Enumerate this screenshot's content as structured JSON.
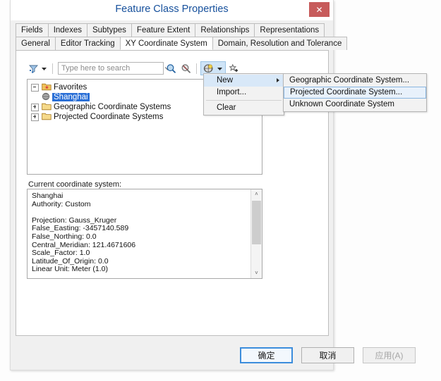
{
  "window": {
    "title": "Feature Class Properties",
    "close_label": "✕"
  },
  "tabs": {
    "row1": [
      {
        "label": "Fields",
        "active": false
      },
      {
        "label": "Indexes",
        "active": false
      },
      {
        "label": "Subtypes",
        "active": false
      },
      {
        "label": "Feature Extent",
        "active": false
      },
      {
        "label": "Relationships",
        "active": false
      },
      {
        "label": "Representations",
        "active": false
      }
    ],
    "row2": [
      {
        "label": "General",
        "active": false
      },
      {
        "label": "Editor Tracking",
        "active": false
      },
      {
        "label": "XY Coordinate System",
        "active": true
      },
      {
        "label": "Domain, Resolution and Tolerance",
        "active": false
      }
    ]
  },
  "toolbar": {
    "filter_icon": "filter-icon",
    "filter_dropdown_icon": "chevron-down-icon",
    "search_placeholder": "Type here to search",
    "search_value": "",
    "search_dropdown_icon": "chevron-down-icon",
    "search_button_icon": "magnifier-icon",
    "cancel_search_icon": "cancel-search-icon",
    "globe_icon": "globe-icon",
    "globe_dropdown_icon": "chevron-down-icon",
    "favorite_icon": "add-favorite-star-icon"
  },
  "tree": {
    "items": [
      {
        "label": "Favorites",
        "level": 0,
        "expander": "minus",
        "icon": "favorites-folder-icon",
        "selected": false
      },
      {
        "label": "Shanghai",
        "level": 1,
        "expander": "none",
        "icon": "globe-small-icon",
        "selected": true
      },
      {
        "label": "Geographic Coordinate Systems",
        "level": 0,
        "expander": "plus",
        "icon": "folder-icon",
        "selected": false
      },
      {
        "label": "Projected Coordinate Systems",
        "level": 0,
        "expander": "plus",
        "icon": "folder-icon",
        "selected": false
      }
    ]
  },
  "details": {
    "label": "Current coordinate system:",
    "text": "Shanghai\nAuthority: Custom\n\nProjection: Gauss_Kruger\nFalse_Easting: -3457140.589\nFalse_Northing: 0.0\nCentral_Meridian: 121.4671606\nScale_Factor: 1.0\nLatitude_Of_Origin: 0.0\nLinear Unit: Meter (1.0)",
    "scroll_up_icon": "˄",
    "scroll_down_icon": "˅"
  },
  "context_menu": {
    "items": [
      {
        "label": "New",
        "highlighted": true,
        "has_submenu": true
      },
      {
        "label": "Import...",
        "highlighted": false,
        "has_submenu": false
      },
      {
        "label": "Clear",
        "highlighted": false,
        "has_submenu": false
      }
    ]
  },
  "submenu": {
    "items": [
      {
        "label": "Geographic Coordinate System...",
        "hovered": false
      },
      {
        "label": "Projected Coordinate System...",
        "hovered": true
      },
      {
        "label": "Unknown Coordinate System",
        "hovered": false
      }
    ]
  },
  "buttons": {
    "ok": "确定",
    "cancel": "取消",
    "apply": "应用(A)"
  },
  "colors": {
    "title_text": "#16509c",
    "close_bg": "#c75b5b",
    "selection_blue": "#2a6fd6",
    "menu_highlight": "#d8e8f8",
    "submenu_hover": "#e8f1fb",
    "default_button_border": "#3c8ddc"
  }
}
